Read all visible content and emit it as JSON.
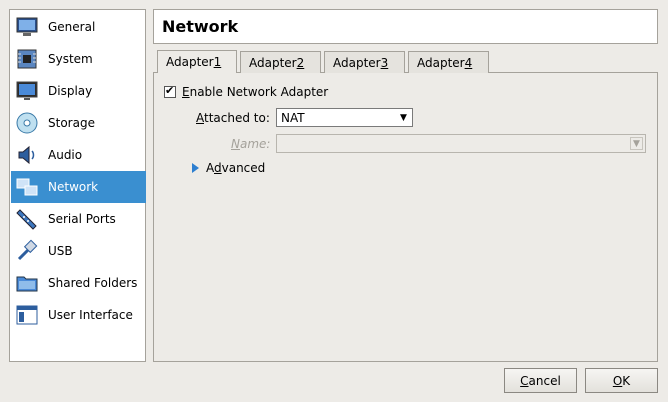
{
  "sidebar": {
    "items": [
      {
        "label": "General",
        "icon": "monitor-icon"
      },
      {
        "label": "System",
        "icon": "chip-icon"
      },
      {
        "label": "Display",
        "icon": "display-icon"
      },
      {
        "label": "Storage",
        "icon": "disc-icon"
      },
      {
        "label": "Audio",
        "icon": "speaker-icon"
      },
      {
        "label": "Network",
        "icon": "network-icon",
        "selected": true
      },
      {
        "label": "Serial Ports",
        "icon": "serial-port-icon"
      },
      {
        "label": "USB",
        "icon": "usb-icon"
      },
      {
        "label": "Shared Folders",
        "icon": "folder-icon"
      },
      {
        "label": "User Interface",
        "icon": "window-icon"
      }
    ],
    "selected_color": "#3a8fd0"
  },
  "header": {
    "title": "Network"
  },
  "tabs": [
    {
      "prefix": "Adapter ",
      "mnemonic": "1",
      "active": true
    },
    {
      "prefix": "Adapter ",
      "mnemonic": "2"
    },
    {
      "prefix": "Adapter ",
      "mnemonic": "3"
    },
    {
      "prefix": "Adapter ",
      "mnemonic": "4"
    }
  ],
  "adapter": {
    "enable_mnemonic": "E",
    "enable_rest": "nable Network Adapter",
    "enabled": true,
    "attached_mnemonic": "A",
    "attached_rest": "ttached to:",
    "attached_value": "NAT",
    "name_mnemonic": "N",
    "name_rest": "ame:",
    "name_value": "",
    "advanced_prefix": "A",
    "advanced_mnemonic": "d",
    "advanced_rest": "vanced"
  },
  "buttons": {
    "cancel_mnemonic": "C",
    "cancel_rest": "ancel",
    "ok_mnemonic": "O",
    "ok_rest": "K"
  }
}
